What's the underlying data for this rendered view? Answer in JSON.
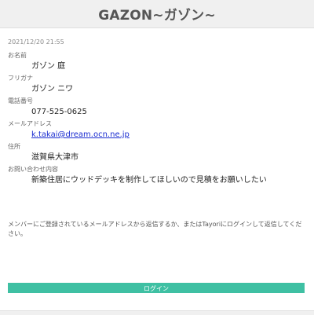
{
  "header": {
    "title": "GAZON~ガゾン~"
  },
  "message": {
    "timestamp": "2021/12/20 21:55",
    "fields": [
      {
        "label": "お名前",
        "value": "ガゾン 庭"
      },
      {
        "label": "フリガナ",
        "value": "ガゾン ニワ"
      },
      {
        "label": "電話番号",
        "value": "077-525-0625"
      },
      {
        "label": "メールアドレス",
        "value": "k.takai@dream.ocn.ne.jp"
      },
      {
        "label": "住所",
        "value": "滋賀県大津市"
      },
      {
        "label": "お問い合わせ内容",
        "value": "新築住居にウッドデッキを制作してほしいので見積をお願いしたい"
      }
    ]
  },
  "reply_note": "メンバーにご登録されているメールアドレスから返信するか、またはTayoriにログインして返信してください。",
  "login_button": "ログイン",
  "colors": {
    "accent": "#3fc0a3",
    "link": "#1a2cd0",
    "header_bg": "#f0f0f0"
  }
}
